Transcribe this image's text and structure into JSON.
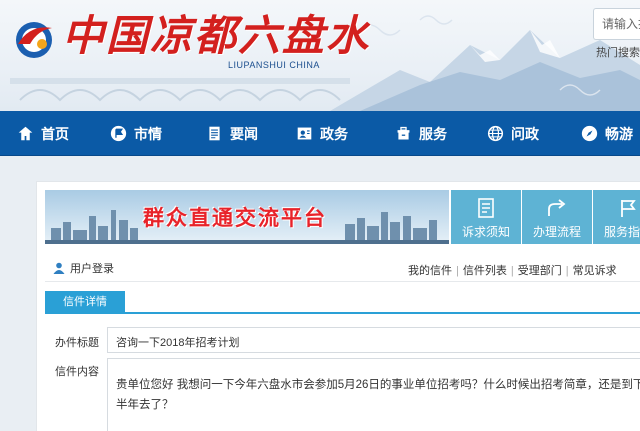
{
  "header": {
    "site_title": "中国凉都六盘水",
    "site_subtitle": "LIUPANSHUI CHINA",
    "search_placeholder": "请输入搜索内容",
    "hot_search_label": "热门搜索：",
    "logo_colors": [
      "#d3201e",
      "#1b5fb0",
      "#f3a51a"
    ]
  },
  "nav": {
    "items": [
      {
        "label": "首页",
        "icon": "home-icon"
      },
      {
        "label": "市情",
        "icon": "flag-icon"
      },
      {
        "label": "要闻",
        "icon": "document-icon"
      },
      {
        "label": "政务",
        "icon": "contact-card-icon"
      },
      {
        "label": "服务",
        "icon": "service-icon"
      },
      {
        "label": "问政",
        "icon": "globe-icon"
      },
      {
        "label": "畅游",
        "icon": "compass-icon"
      }
    ]
  },
  "banner": {
    "title": "群众直通交流平台",
    "quick_buttons": [
      {
        "label": "诉求须知",
        "icon": "notice-icon"
      },
      {
        "label": "办理流程",
        "icon": "share-arrow-icon"
      },
      {
        "label": "服务指南",
        "icon": "flag-outline-icon"
      }
    ]
  },
  "user_bar": {
    "login_label": "用户登录",
    "links": [
      "我的信件",
      "信件列表",
      "受理部门",
      "常见诉求"
    ]
  },
  "tab": {
    "active_label": "信件详情"
  },
  "letter": {
    "subject_label": "办件标题",
    "subject_value": "咨询一下2018年招考计划",
    "content_label": "信件内容",
    "content_value": "贵单位您好 我想问一下今年六盘水市会参加5月26日的事业单位招考吗？什么时候出招考简章，还是到下半年去了？"
  },
  "colors": {
    "nav_bg": "#0b5aa6",
    "accent": "#2aa0d6",
    "quick_btn": "#5eb3d4",
    "title_red": "#d3201e"
  }
}
